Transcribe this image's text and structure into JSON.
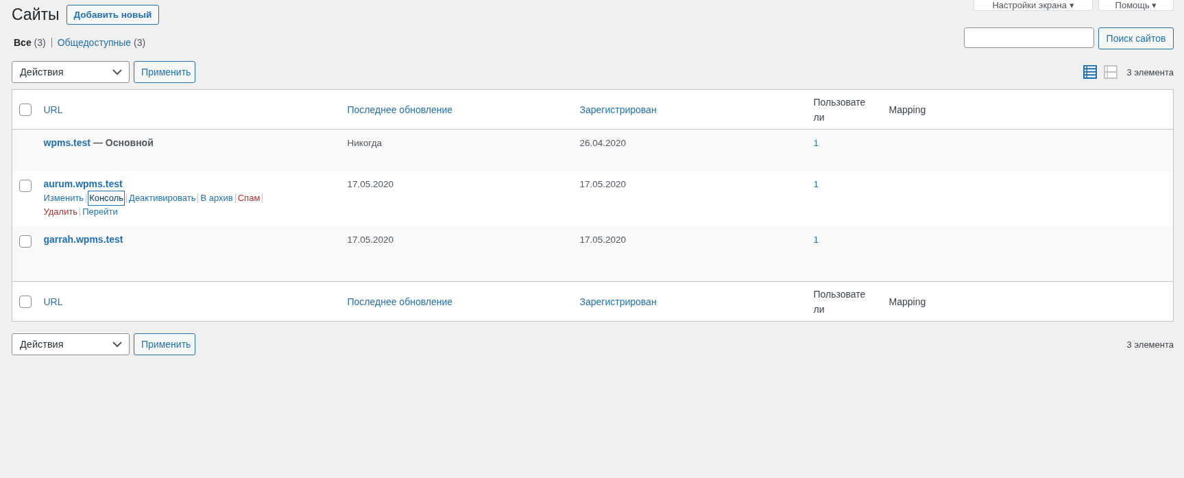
{
  "screen_tabs": [
    {
      "label": "Настройки экрана",
      "caret": "▾"
    },
    {
      "label": "Помощь",
      "caret": "▾"
    }
  ],
  "title": "Сайты",
  "add_button": "Добавить новый",
  "filters": [
    {
      "label": "Все",
      "count": "(3)",
      "selected": true
    },
    {
      "label": "Общедоступные",
      "count": "(3)",
      "selected": false
    }
  ],
  "search": {
    "button": "Поиск сайтов"
  },
  "bulk_top": {
    "value": "Действия",
    "apply": "Применить"
  },
  "view_modes": [
    {
      "kind": "list",
      "selected": true
    },
    {
      "kind": "excerpt",
      "selected": false
    }
  ],
  "count_top": "3 элемента",
  "table_header": {
    "checked": false,
    "columns": [
      {
        "label": "URL",
        "kind": "sort"
      },
      {
        "label": "Последнее обновление",
        "kind": "sort"
      },
      {
        "label": "Зарегистрирован",
        "kind": "sort"
      },
      {
        "label": "Пользователи",
        "kind": "plain"
      },
      {
        "label": "Mapping",
        "kind": "plain"
      }
    ]
  },
  "rows": [
    {
      "url": "wpms.test",
      "suffix": "— Основной",
      "updated": "Никогда",
      "registered": "26.04.2020",
      "users": "1",
      "actions": []
    },
    {
      "url": "aurum.wpms.test",
      "checked": false,
      "updated": "17.05.2020",
      "registered": "17.05.2020",
      "users": "1",
      "actions": [
        {
          "label": "Изменить",
          "kind": "link",
          "focused": false
        },
        {
          "label": "Консоль",
          "kind": "link",
          "focused": true
        },
        {
          "label": "Деактивировать",
          "kind": "link",
          "focused": false
        },
        {
          "label": "В архив",
          "kind": "link",
          "focused": false
        },
        {
          "label": "Спам",
          "kind": "danger",
          "focused": false
        },
        {
          "label": "Удалить",
          "kind": "danger",
          "focused": false
        },
        {
          "label": "Перейти",
          "kind": "link",
          "focused": false
        }
      ]
    },
    {
      "url": "garrah.wpms.test",
      "checked": false,
      "updated": "17.05.2020",
      "registered": "17.05.2020",
      "users": "1",
      "actions": []
    }
  ],
  "table_footer": {
    "checked": false,
    "columns": [
      {
        "label": "URL",
        "kind": "sort"
      },
      {
        "label": "Последнее обновление",
        "kind": "sort"
      },
      {
        "label": "Зарегистрирован",
        "kind": "sort"
      },
      {
        "label": "Пользователи",
        "kind": "plain"
      },
      {
        "label": "Mapping",
        "kind": "plain"
      }
    ]
  },
  "bulk_bottom": {
    "value": "Действия",
    "apply": "Применить"
  },
  "count_bottom": "3 элемента"
}
